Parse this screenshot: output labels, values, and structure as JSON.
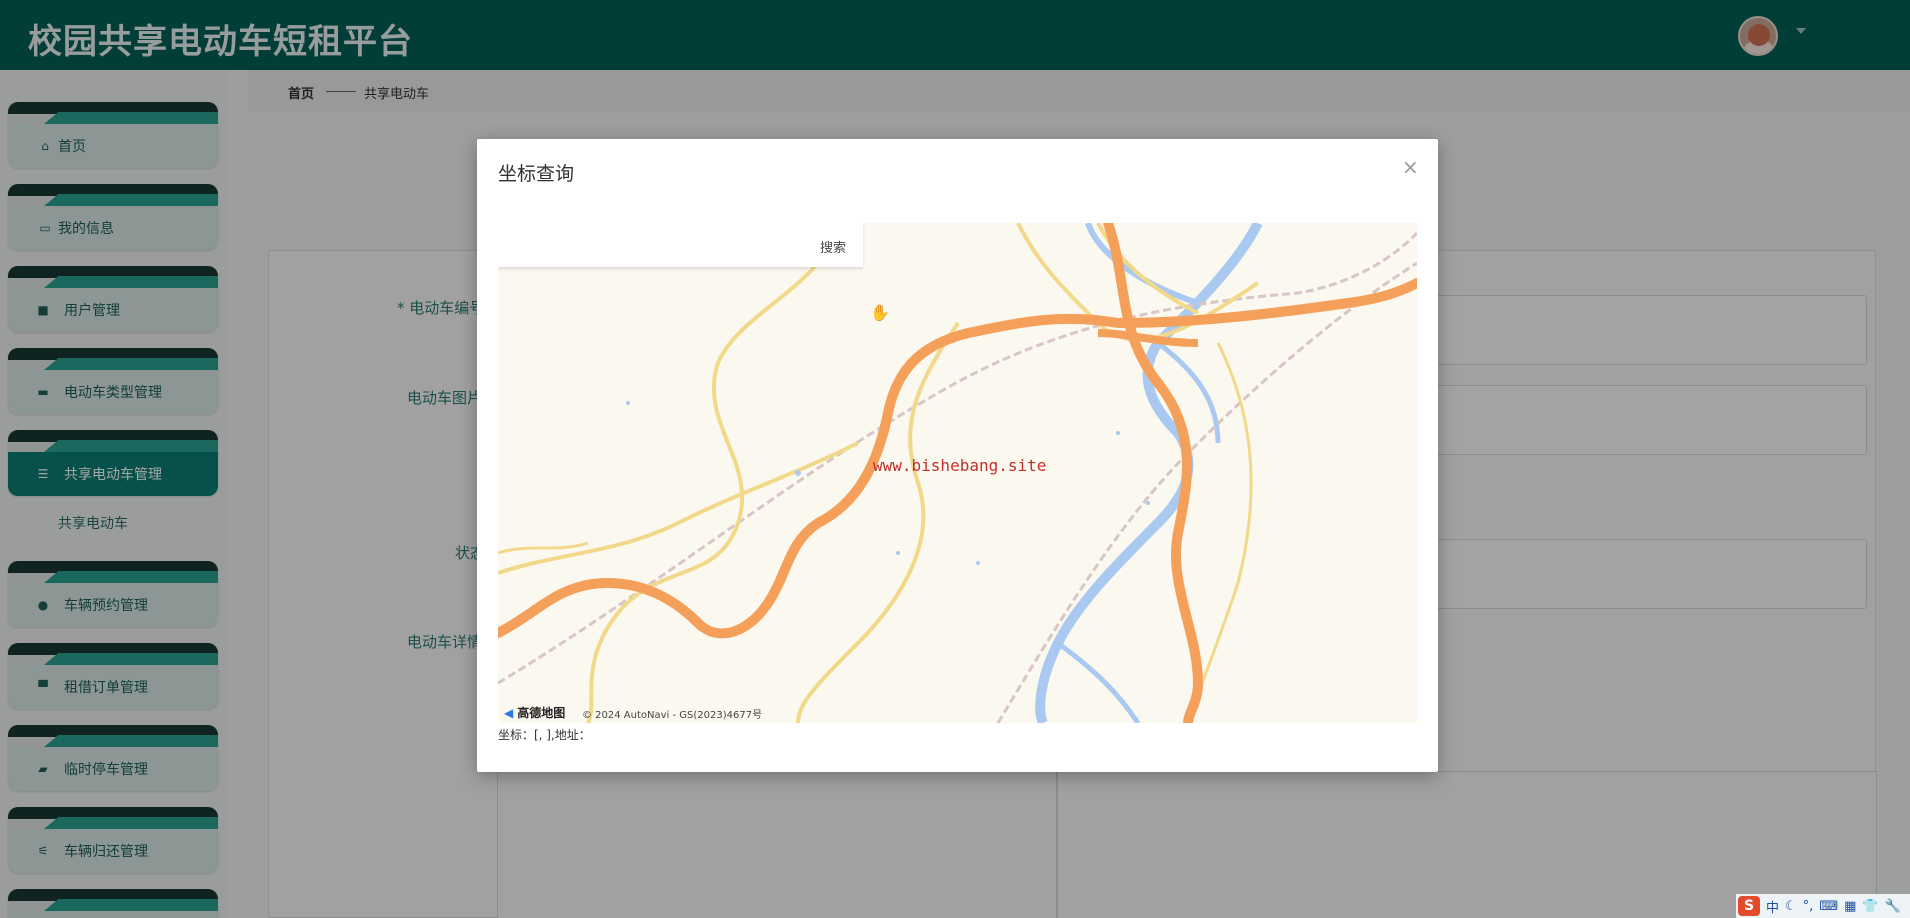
{
  "header": {
    "title": "校园共享电动车短租平台"
  },
  "sidebar": {
    "items": [
      {
        "label": "首页",
        "icon": "home-icon",
        "glyph": "⌂"
      },
      {
        "label": "我的信息",
        "icon": "id-card-icon",
        "glyph": "▭"
      },
      {
        "label": "用户管理",
        "icon": "chat-icon",
        "glyph": "■"
      },
      {
        "label": "电动车类型管理",
        "icon": "ticket-icon",
        "glyph": "▬"
      },
      {
        "label": "共享电动车管理",
        "icon": "list-icon",
        "glyph": "☰"
      },
      {
        "label": "车辆预约管理",
        "icon": "pin-icon",
        "glyph": "●"
      },
      {
        "label": "租借订单管理",
        "icon": "monitor-icon",
        "glyph": "▀"
      },
      {
        "label": "临时停车管理",
        "icon": "wallet-icon",
        "glyph": "▰"
      },
      {
        "label": "车辆归还管理",
        "icon": "sliders-icon",
        "glyph": "⚟"
      }
    ],
    "submenu_item": "共享电动车"
  },
  "breadcrumb": {
    "home": "首页",
    "current": "共享电动车"
  },
  "form": {
    "labels": [
      "* 电动车编号",
      "电动车图片",
      "状态",
      "电动车详情"
    ]
  },
  "modal": {
    "title": "坐标查询",
    "close": "×",
    "search_placeholder": "",
    "search_button": "搜索",
    "watermark": "www.bishebang.site",
    "map_logo": "高德地图",
    "map_copyright": "© 2024 AutoNavi - GS(2023)4677号",
    "coord_line": "坐标：[, ],地址："
  },
  "tray": {
    "ime_mode": "中",
    "items": [
      "☾",
      "°,",
      "⌨",
      "▦",
      "👕",
      "🔧"
    ]
  },
  "colors": {
    "header": "#055f55",
    "accent": "#0a7d70",
    "road_major": "#f4a05a",
    "road_minor": "#f2d98a",
    "water": "#a9c9f0"
  }
}
